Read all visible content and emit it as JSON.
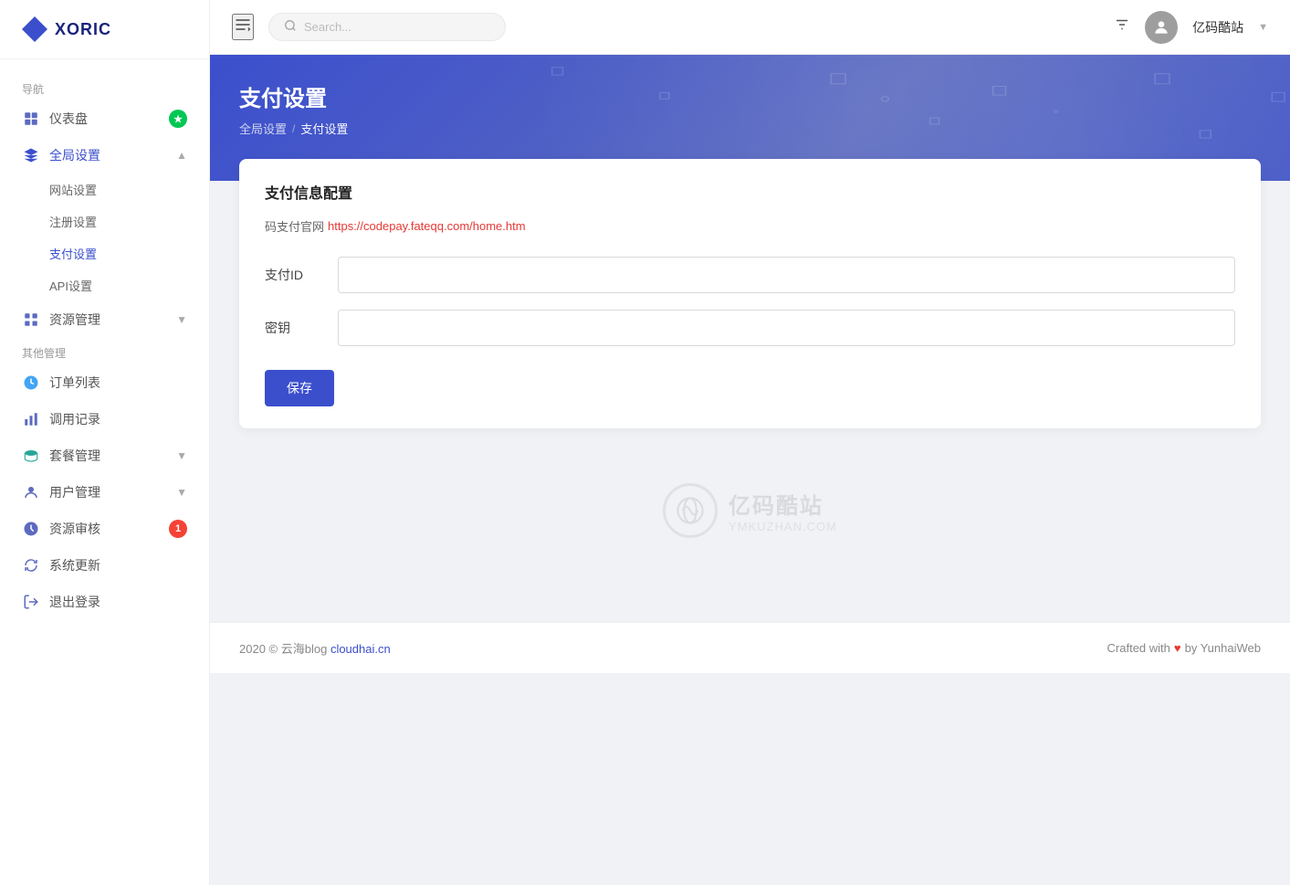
{
  "app": {
    "logo_text": "XORIC"
  },
  "sidebar": {
    "nav_label": "导航",
    "other_label": "其他管理",
    "items": [
      {
        "id": "dashboard",
        "label": "仪表盘",
        "icon": "dashboard",
        "badge": "★",
        "badge_color": "green"
      },
      {
        "id": "global-settings",
        "label": "全局设置",
        "icon": "settings",
        "expanded": true
      },
      {
        "id": "website-settings",
        "label": "网站设置",
        "sub": true
      },
      {
        "id": "register-settings",
        "label": "注册设置",
        "sub": true
      },
      {
        "id": "payment-settings",
        "label": "支付设置",
        "sub": true,
        "active": true
      },
      {
        "id": "api-settings",
        "label": "API设置",
        "sub": true
      },
      {
        "id": "resource-management",
        "label": "资源管理",
        "icon": "grid",
        "expandable": true
      },
      {
        "id": "orders",
        "label": "订单列表",
        "icon": "orders",
        "other": true
      },
      {
        "id": "call-records",
        "label": "调用记录",
        "icon": "chart",
        "other": true
      },
      {
        "id": "package-management",
        "label": "套餐管理",
        "icon": "package",
        "expandable": true,
        "other": true
      },
      {
        "id": "user-management",
        "label": "用户管理",
        "icon": "user",
        "expandable": true,
        "other": true
      },
      {
        "id": "resource-review",
        "label": "资源审核",
        "icon": "review",
        "badge": "1",
        "badge_color": "red",
        "other": true
      },
      {
        "id": "system-update",
        "label": "系统更新",
        "icon": "update",
        "other": true
      },
      {
        "id": "logout",
        "label": "退出登录",
        "icon": "logout",
        "other": true
      }
    ]
  },
  "header": {
    "search_placeholder": "Search...",
    "user_name": "亿码酷站",
    "filter_icon": "filter",
    "collapse_icon": "collapse"
  },
  "page": {
    "title": "支付设置",
    "breadcrumbs": [
      "全局设置",
      "支付设置"
    ]
  },
  "payment_card": {
    "title": "支付信息配置",
    "subtitle_text": "码支付官网",
    "subtitle_link": "https://codepay.fateqq.com/home.htm",
    "fields": [
      {
        "label": "支付ID",
        "id": "payment-id",
        "value": ""
      },
      {
        "label": "密钥",
        "id": "secret-key",
        "value": ""
      }
    ],
    "save_button": "保存"
  },
  "watermark": {
    "name": "亿码酷站",
    "url": "YMKUZHAN.COM"
  },
  "footer": {
    "left_text": "2020 © 云海blog",
    "left_link_text": "cloudhai.cn",
    "left_link_url": "cloudhai.cn",
    "right_text": "Crafted with",
    "right_suffix": "by YunhaiWeb"
  }
}
